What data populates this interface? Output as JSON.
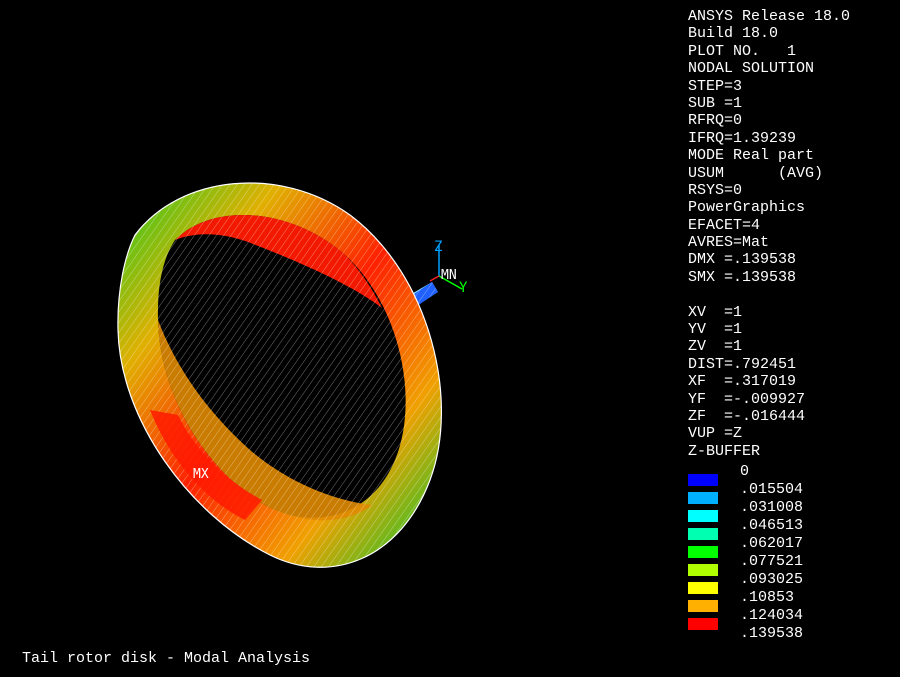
{
  "info_lines": [
    "ANSYS Release 18.0",
    "Build 18.0",
    "PLOT NO.   1",
    "NODAL SOLUTION",
    "STEP=3",
    "SUB =1",
    "RFRQ=0",
    "IFRQ=1.39239",
    "MODE Real part",
    "USUM      (AVG)",
    "RSYS=0",
    "PowerGraphics",
    "EFACET=4",
    "AVRES=Mat",
    "DMX =.139538",
    "SMX =.139538"
  ],
  "view_lines": [
    "XV  =1",
    "YV  =1",
    "ZV  =1",
    "DIST=.792451",
    "XF  =.317019",
    "YF  =-.009927",
    "ZF  =-.016444",
    "VUP =Z",
    "Z-BUFFER"
  ],
  "legend": {
    "colors": [
      "#0000ff",
      "#00b0ff",
      "#00ffff",
      "#00ffb0",
      "#00ff00",
      "#b0ff00",
      "#ffff00",
      "#ffb000",
      "#ff0000"
    ],
    "values": [
      "0",
      ".015504",
      ".031008",
      ".046513",
      ".062017",
      ".077521",
      ".093025",
      ".10853",
      ".124034",
      ".139538"
    ]
  },
  "triad": {
    "z": "Z",
    "y": "Y",
    "mn": "MN"
  },
  "mx_label": "MX",
  "caption": "Tail rotor disk - Modal Analysis"
}
